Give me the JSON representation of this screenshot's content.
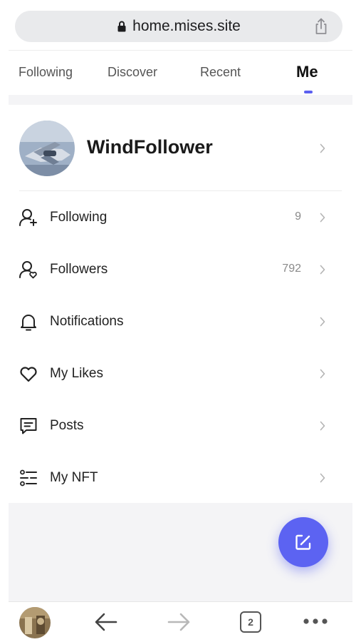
{
  "browser": {
    "url": "home.mises.site",
    "icons": {
      "lock": "lock-icon",
      "share": "share-icon"
    }
  },
  "tabs": [
    {
      "label": "Following",
      "active": false
    },
    {
      "label": "Discover",
      "active": false
    },
    {
      "label": "Recent",
      "active": false
    },
    {
      "label": "Me",
      "active": true
    }
  ],
  "profile": {
    "username": "WindFollower",
    "avatar": "avatar-image"
  },
  "menu": [
    {
      "label": "Following",
      "count": "9",
      "icon": "user-add-icon"
    },
    {
      "label": "Followers",
      "count": "792",
      "icon": "user-heart-icon"
    },
    {
      "label": "Notifications",
      "count": "",
      "icon": "bell-icon"
    },
    {
      "label": "My Likes",
      "count": "",
      "icon": "heart-icon"
    },
    {
      "label": "Posts",
      "count": "",
      "icon": "message-square-icon"
    },
    {
      "label": "My NFT",
      "count": "",
      "icon": "sliders-icon"
    }
  ],
  "fab": {
    "icon": "edit-icon"
  },
  "bottom_nav": {
    "tab_count": "2",
    "icons": [
      "avatar",
      "arrow-left-icon",
      "arrow-right-icon",
      "tabs-icon",
      "more-icon"
    ]
  },
  "colors": {
    "accent": "#5c63f2",
    "muted": "#8a8a8a",
    "divider": "#f4f4f6"
  }
}
